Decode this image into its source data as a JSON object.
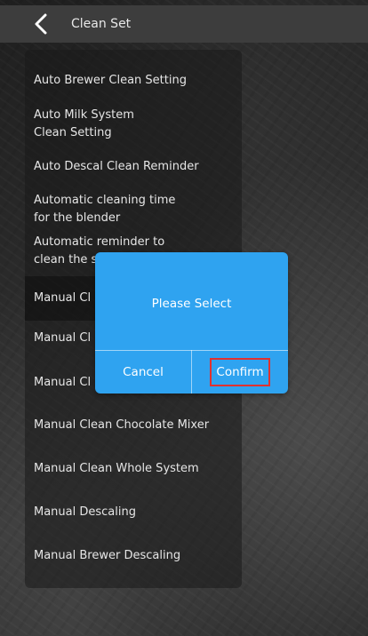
{
  "header": {
    "back_icon": "chevron-left-icon",
    "title": "Clean Set"
  },
  "menu": {
    "items": [
      {
        "line1": "Auto Brewer Clean Setting",
        "line2": ""
      },
      {
        "line1": "Auto Milk System",
        "line2": "Clean Setting"
      },
      {
        "line1": "Auto Descal Clean Reminder",
        "line2": ""
      },
      {
        "line1": "Automatic cleaning time",
        "line2": "for the blender"
      },
      {
        "line1": "Automatic reminder to",
        "line2": "clean the s"
      },
      {
        "line1": "Manual Cl",
        "line2": ""
      },
      {
        "line1": "Manual Cl",
        "line2": ""
      },
      {
        "line1": "Manual Cl",
        "line2": ""
      },
      {
        "line1": "Manual Clean Chocolate Mixer",
        "line2": ""
      },
      {
        "line1": "Manual Clean Whole System",
        "line2": ""
      },
      {
        "line1": "Manual Descaling",
        "line2": ""
      },
      {
        "line1": "Manual Brewer Descaling",
        "line2": ""
      }
    ],
    "selected_index": 5
  },
  "dialog": {
    "message": "Please Select",
    "cancel_label": "Cancel",
    "confirm_label": "Confirm"
  },
  "colors": {
    "dialog_bg": "#2fa3f0",
    "highlight_border": "#e0312f",
    "topbar_bg": "#3d3d3d"
  }
}
